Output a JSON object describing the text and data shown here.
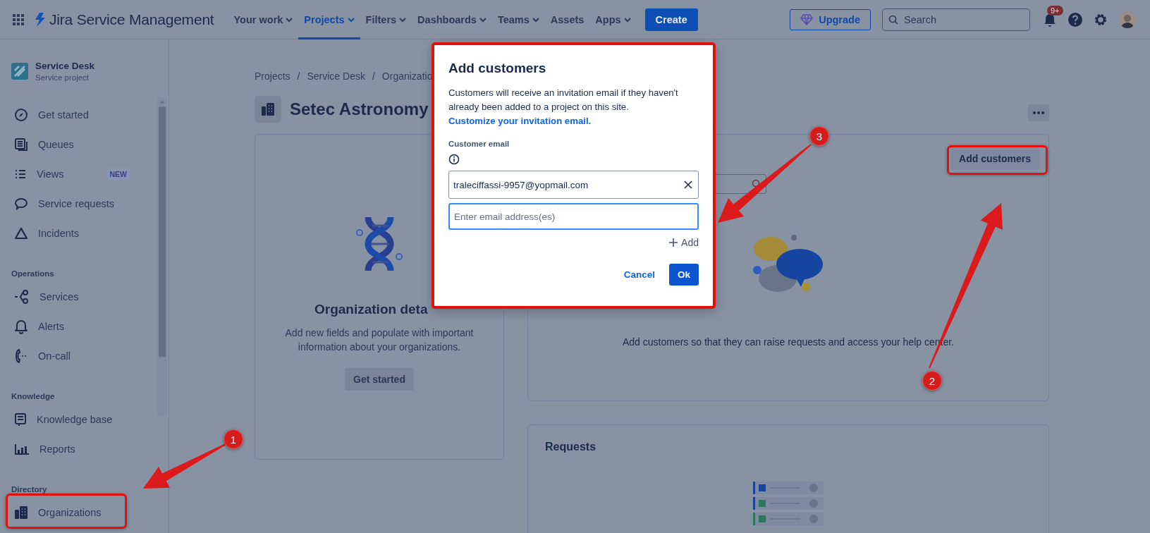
{
  "topbar": {
    "app_name": "Jira Service Management",
    "nav": [
      {
        "label": "Your work",
        "dropdown": true,
        "selected": false
      },
      {
        "label": "Projects",
        "dropdown": true,
        "selected": true
      },
      {
        "label": "Filters",
        "dropdown": true,
        "selected": false
      },
      {
        "label": "Dashboards",
        "dropdown": true,
        "selected": false
      },
      {
        "label": "Teams",
        "dropdown": true,
        "selected": false
      },
      {
        "label": "Assets",
        "dropdown": false,
        "selected": false
      },
      {
        "label": "Apps",
        "dropdown": true,
        "selected": false
      }
    ],
    "create": "Create",
    "upgrade": "Upgrade",
    "search": {
      "placeholder": "Search"
    },
    "notifications_badge": "9+"
  },
  "sidebar": {
    "project": {
      "name": "Service Desk",
      "type": "Service project"
    },
    "sections": [
      {
        "items": [
          {
            "label": "Get started"
          },
          {
            "label": "Queues"
          },
          {
            "label": "Views",
            "badge": "NEW"
          },
          {
            "label": "Service requests"
          },
          {
            "label": "Incidents"
          }
        ]
      },
      {
        "heading": "Operations",
        "items": [
          {
            "label": "Services"
          },
          {
            "label": "Alerts"
          },
          {
            "label": "On-call"
          }
        ]
      },
      {
        "heading": "Knowledge",
        "items": [
          {
            "label": "Knowledge base"
          },
          {
            "label": "Reports"
          }
        ]
      },
      {
        "heading": "Directory",
        "items": [
          {
            "label": "Organizations"
          }
        ]
      }
    ]
  },
  "breadcrumbs": [
    "Projects",
    "Service Desk",
    "Organizatio"
  ],
  "breadcrumb_separator": "/",
  "page_title": "Setec Astronomy",
  "organization_card": {
    "title": "Organization deta",
    "description": "Add new fields and populate with important information about your organizations.",
    "button": "Get started"
  },
  "customers_card": {
    "button": "Add customers",
    "empty_text": "Add customers so that they can raise requests and access your help center."
  },
  "requests_card": {
    "title": "Requests"
  },
  "dialog": {
    "title": "Add customers",
    "description": "Customers will receive an invitation email if they haven't already been added to a project on this site.",
    "link": "Customize your invitation email.",
    "field_label": "Customer email",
    "emails": [
      "traleciffassi-9957@yopmail.com"
    ],
    "input": {
      "placeholder": "Enter email address(es)"
    },
    "add": "Add",
    "cancel": "Cancel",
    "ok": "Ok"
  },
  "annotations": [
    {
      "label": "1"
    },
    {
      "label": "2"
    },
    {
      "label": "3"
    }
  ]
}
